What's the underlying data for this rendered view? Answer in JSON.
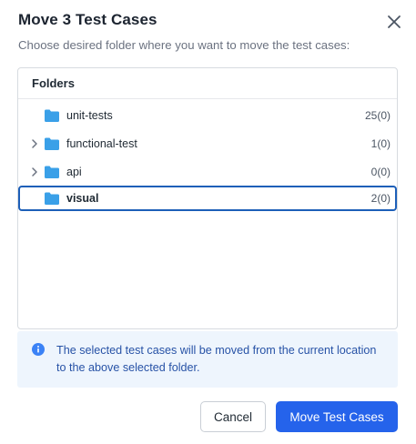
{
  "dialog": {
    "title": "Move 3 Test Cases",
    "subtitle": "Choose desired folder where you want to move the test cases:",
    "close_icon": "close-icon"
  },
  "folders": {
    "header": "Folders",
    "items": [
      {
        "name": "unit-tests",
        "count": "25(0)",
        "expandable": false,
        "selected": false
      },
      {
        "name": "functional-test",
        "count": "1(0)",
        "expandable": true,
        "selected": false
      },
      {
        "name": "api",
        "count": "0(0)",
        "expandable": true,
        "selected": false
      },
      {
        "name": "visual",
        "count": "2(0)",
        "expandable": false,
        "selected": true
      }
    ]
  },
  "info": {
    "icon": "info-icon",
    "text": "The selected test cases will be moved from the current location to the above selected folder."
  },
  "actions": {
    "cancel_label": "Cancel",
    "confirm_label": "Move Test Cases"
  },
  "colors": {
    "accent": "#2563eb",
    "folder_icon": "#3aa0e8",
    "selected_border": "#1d5fb8",
    "info_bg": "#eef5fd",
    "info_text": "#2752a6"
  }
}
